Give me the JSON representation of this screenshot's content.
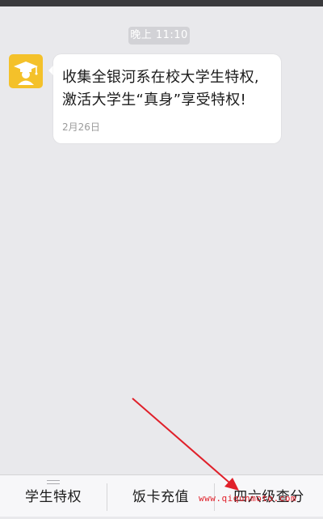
{
  "chat": {
    "timestamp": "晚上 11:10",
    "message": {
      "line1": "收集全银河系在校大学生特权,",
      "line2": "激活大学生“真身”享受特权!",
      "date": "2月26日"
    },
    "avatar_icon": "graduate-cap-icon"
  },
  "bottom_menu": {
    "items": [
      {
        "label": "学生特权"
      },
      {
        "label": "饭卡充值"
      },
      {
        "label": "四六级查分"
      }
    ]
  },
  "annotation": {
    "watermark": "www.qiqunmoto.com",
    "arrow_color": "#e0202a"
  }
}
